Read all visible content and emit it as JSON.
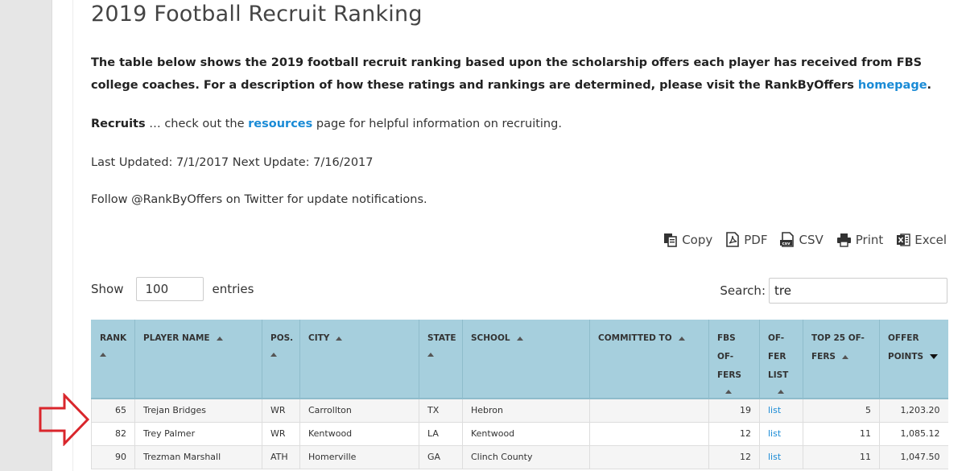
{
  "page": {
    "title": "2019 Football Recruit Ranking",
    "intro_text": "The table below shows the 2019 football recruit ranking based upon the scholarship offers each player has received from FBS college coaches. For a description of how these ratings and rankings are determined, please visit the RankByOffers ",
    "intro_link": "homepage",
    "intro_end": ".",
    "recruits_bold": "Recruits",
    "recruits_text_1": " … check out the ",
    "resources_link": "resources",
    "recruits_text_2": " page for helpful information on recruiting.",
    "updated_text": "Last Updated: 7/1/2017 Next Update: 7/16/2017",
    "follow_text": "Follow @RankByOffers on Twitter for update notifications."
  },
  "toolbar": {
    "buttons": [
      {
        "label": "Copy",
        "icon": "copy-icon"
      },
      {
        "label": "PDF",
        "icon": "pdf-icon"
      },
      {
        "label": "CSV",
        "icon": "csv-icon"
      },
      {
        "label": "Print",
        "icon": "print-icon"
      },
      {
        "label": "Excel",
        "icon": "excel-icon"
      }
    ]
  },
  "length": {
    "show_label": "Show",
    "value": "100",
    "entries_label": "entries"
  },
  "search": {
    "label": "Search:",
    "value": "tre"
  },
  "table": {
    "headers": [
      {
        "line1": "RANK",
        "line2": ""
      },
      {
        "line1": "PLAYER NAME",
        "line2": ""
      },
      {
        "line1": "POS.",
        "line2": ""
      },
      {
        "line1": "CITY",
        "line2": ""
      },
      {
        "line1": "STATE",
        "line2": ""
      },
      {
        "line1": "SCHOOL",
        "line2": ""
      },
      {
        "line1": "COMMITTED TO",
        "line2": ""
      },
      {
        "line1": "FBS OF-",
        "line2": "FERS"
      },
      {
        "line1": "OF-",
        "line2": "FER",
        "line3": "LIST"
      },
      {
        "line1": "TOP 25 OF-",
        "line2": "FERS"
      },
      {
        "line1": "OFFER",
        "line2": "POINTS"
      }
    ],
    "rows": [
      {
        "rank": "65",
        "name": "Trejan Bridges",
        "pos": "WR",
        "city": "Carrollton",
        "state": "TX",
        "school": "Hebron",
        "committed": "",
        "fbs_offers": "19",
        "offer_list": "list",
        "top25": "5",
        "points": "1,203.20"
      },
      {
        "rank": "82",
        "name": "Trey Palmer",
        "pos": "WR",
        "city": "Kentwood",
        "state": "LA",
        "school": "Kentwood",
        "committed": "",
        "fbs_offers": "12",
        "offer_list": "list",
        "top25": "11",
        "points": "1,085.12"
      },
      {
        "rank": "90",
        "name": "Trezman Marshall",
        "pos": "ATH",
        "city": "Homerville",
        "state": "GA",
        "school": "Clinch County",
        "committed": "",
        "fbs_offers": "12",
        "offer_list": "list",
        "top25": "11",
        "points": "1,047.50"
      }
    ]
  },
  "colors": {
    "header_bg": "#a6cfdd",
    "link": "#1a8bd6",
    "annotation_arrow": "#d9262c"
  }
}
